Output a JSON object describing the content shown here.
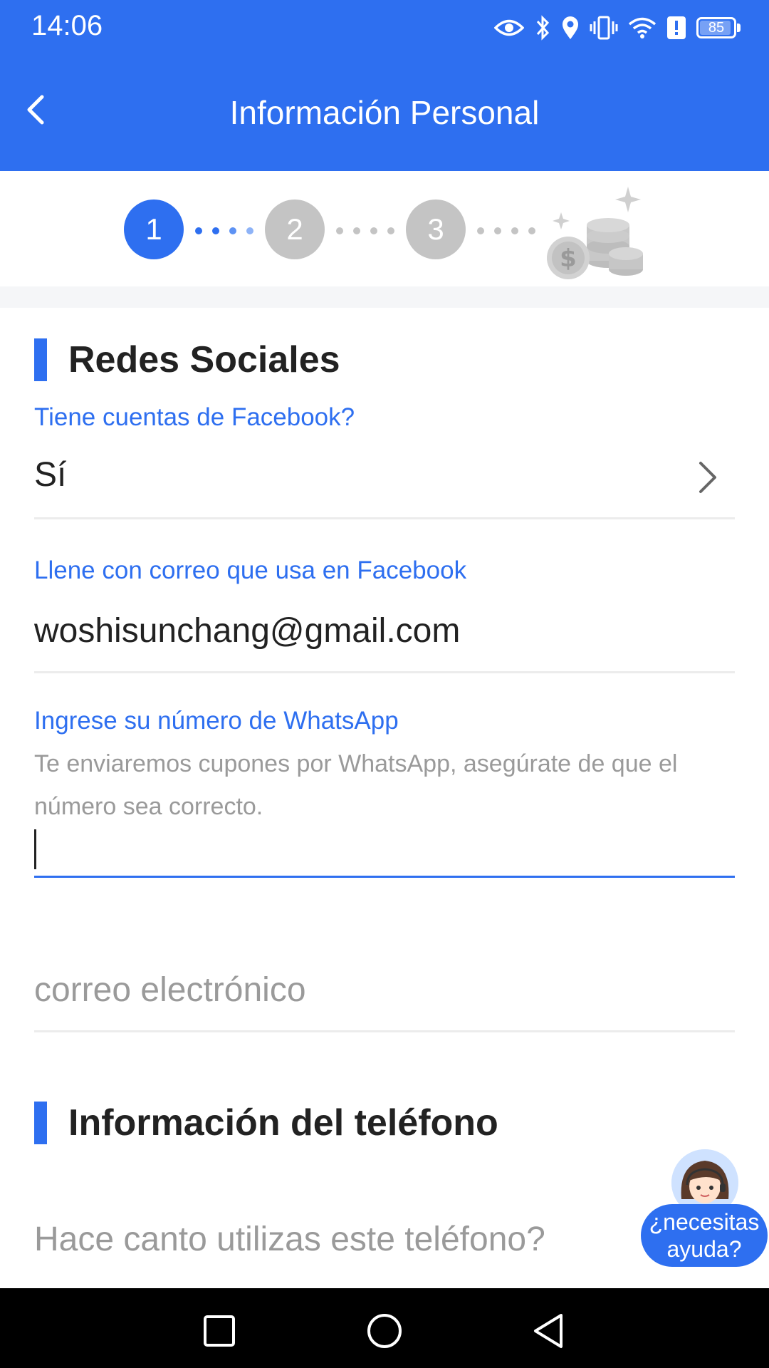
{
  "status_bar": {
    "time": "14:06",
    "battery": "85",
    "icons": [
      "eye-icon",
      "bluetooth-icon",
      "location-icon",
      "vibrate-icon",
      "wifi-icon",
      "alert-icon",
      "battery-icon"
    ]
  },
  "header": {
    "title": "Información Personal",
    "back_icon": "chevron-left-icon",
    "background": "#2e6ff0"
  },
  "stepper": {
    "steps": [
      "1",
      "2",
      "3"
    ],
    "current": 1,
    "active_color": "#2e6ff0",
    "inactive_color": "#c4c4c4",
    "final_icon": "coins-icon"
  },
  "section_social": {
    "title": "Redes Sociales",
    "facebook_question": "Tiene cuentas de Facebook?",
    "facebook_answer": "Sí",
    "facebook_email_label": "Llene con correo que usa en Facebook",
    "facebook_email_value": "woshisunchang@gmail.com",
    "whatsapp_label": "Ingrese su número de WhatsApp",
    "whatsapp_hint": "Te enviaremos cupones por WhatsApp, asegúrate de que el número sea correcto.",
    "whatsapp_value": "",
    "email_placeholder": "correo electrónico"
  },
  "section_phone": {
    "title": "Información del teléfono",
    "usage_placeholder": "Hace canto utilizas este teléfono?"
  },
  "help": {
    "line1": "¿necesitas",
    "line2": "ayuda?"
  },
  "navbar": {
    "buttons": [
      "recent-apps-icon",
      "home-icon",
      "back-icon"
    ]
  }
}
